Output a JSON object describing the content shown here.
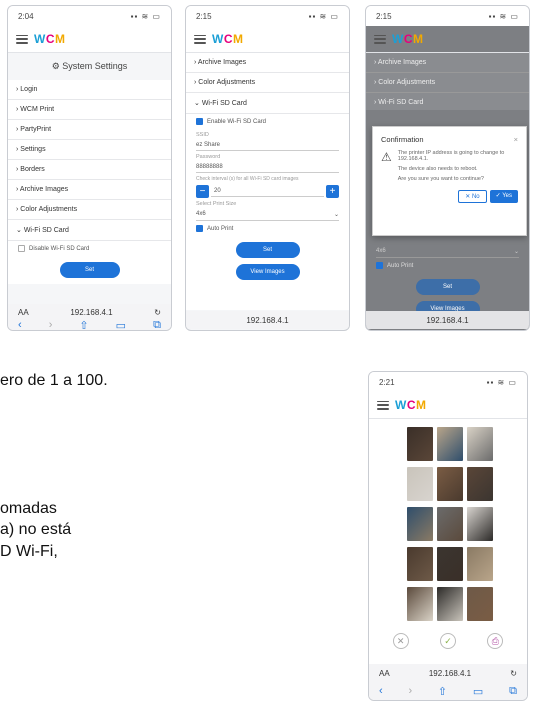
{
  "phone1": {
    "time": "2:04",
    "section_title": "System Settings",
    "menu": [
      "Login",
      "WCM Print",
      "PartyPrint",
      "Settings",
      "Borders",
      "Archive Images",
      "Color Adjustments"
    ],
    "open_section": "Wi-Fi SD Card",
    "checkbox_label": "Disable Wi-Fi SD Card",
    "set_button": "Set",
    "url": "192.168.4.1",
    "aa": "AA"
  },
  "phone2": {
    "time": "2:15",
    "menu": [
      "Archive Images",
      "Color Adjustments"
    ],
    "open_section": "Wi-Fi SD Card",
    "enable_label": "Enable Wi-Fi SD Card",
    "ssid_label": "SSID",
    "ssid_value": "ez Share",
    "password_label": "Password",
    "password_value": "88888888",
    "interval_label": "Check interval (s) for all Wi-Fi SD card images",
    "interval_value": "20",
    "size_label": "Select Print Size",
    "size_value": "4x6",
    "auto_print_label": "Auto Print",
    "set_button": "Set",
    "view_images_button": "View Images",
    "url": "192.168.4.1"
  },
  "phone3": {
    "time": "2:15",
    "menu": [
      "Archive Images",
      "Color Adjustments",
      "Wi-Fi SD Card"
    ],
    "dialog_title": "Confirmation",
    "dialog_line1": "The printer IP address is going to change to 192.168.4.1.",
    "dialog_line2": "The device also needs to reboot.",
    "dialog_line3": "Are you sure you want to continue?",
    "no_button": "No",
    "yes_button": "Yes",
    "size_value": "4x6",
    "auto_print_label": "Auto Print",
    "set_button": "Set",
    "view_images_button": "View Images",
    "url": "192.168.4.1"
  },
  "phone4": {
    "time": "2:21",
    "url": "192.168.4.1",
    "aa": "AA",
    "icon_colors": [
      "#9a9a9a",
      "#8bb34a",
      "#b04fa3"
    ]
  },
  "logo": {
    "w": "W",
    "c": "C",
    "m": "M"
  },
  "doc": {
    "line1": "ero de 1 a 100.",
    "line2": "omadas",
    "line3": "a) no está",
    "line4": "D Wi-Fi,"
  },
  "colors": {
    "accent": "#1e73d8",
    "logo_w": "#1b9fd6",
    "logo_c": "#e6007e",
    "logo_m": "#f2a900"
  }
}
